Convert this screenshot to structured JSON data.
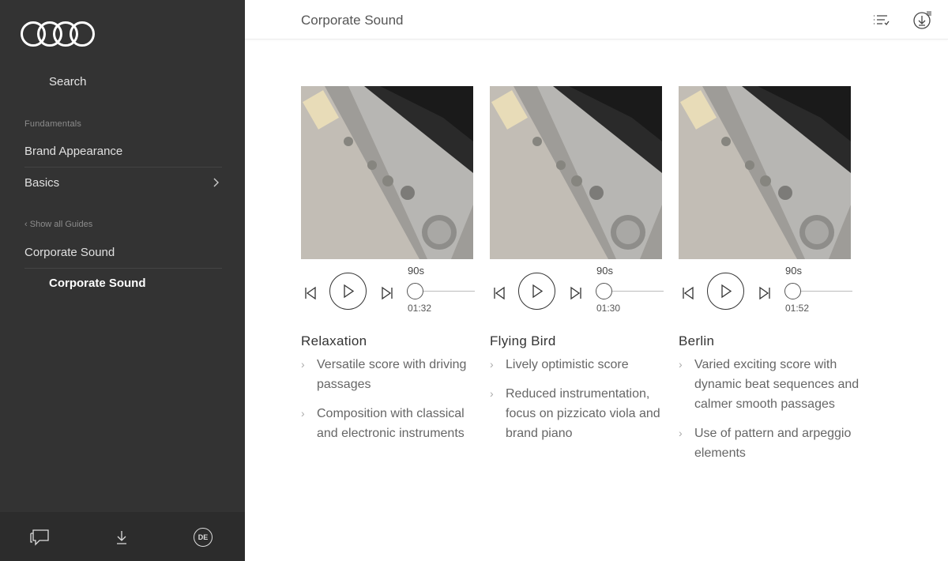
{
  "sidebar": {
    "search_label": "Search",
    "section_label": "Fundamentals",
    "items": [
      {
        "label": "Brand Appearance"
      },
      {
        "label": "Basics"
      }
    ],
    "back_label": "Show all Guides",
    "guide_title": "Corporate Sound",
    "active_sub": "Corporate Sound",
    "footer": {
      "lang": "DE"
    }
  },
  "header": {
    "title": "Corporate Sound"
  },
  "tracks": [
    {
      "title": "Relaxation",
      "duration": "90s",
      "time": "01:32",
      "bullets": [
        "Versatile score with driving passages",
        "Composition with classical and electronic instruments"
      ]
    },
    {
      "title": "Flying Bird",
      "duration": "90s",
      "time": "01:30",
      "bullets": [
        "Lively optimistic score",
        "Reduced instrumentation, focus on pizzicato viola and brand piano"
      ]
    },
    {
      "title": "Berlin",
      "duration": "90s",
      "time": "01:52",
      "bullets": [
        "Varied exciting score with dynamic beat sequences and calmer smooth passages",
        "Use of pattern and arpeggio elements"
      ]
    }
  ],
  "colors": {
    "sidebar_bg": "#333333",
    "footer_bg": "#2c2c2c"
  }
}
